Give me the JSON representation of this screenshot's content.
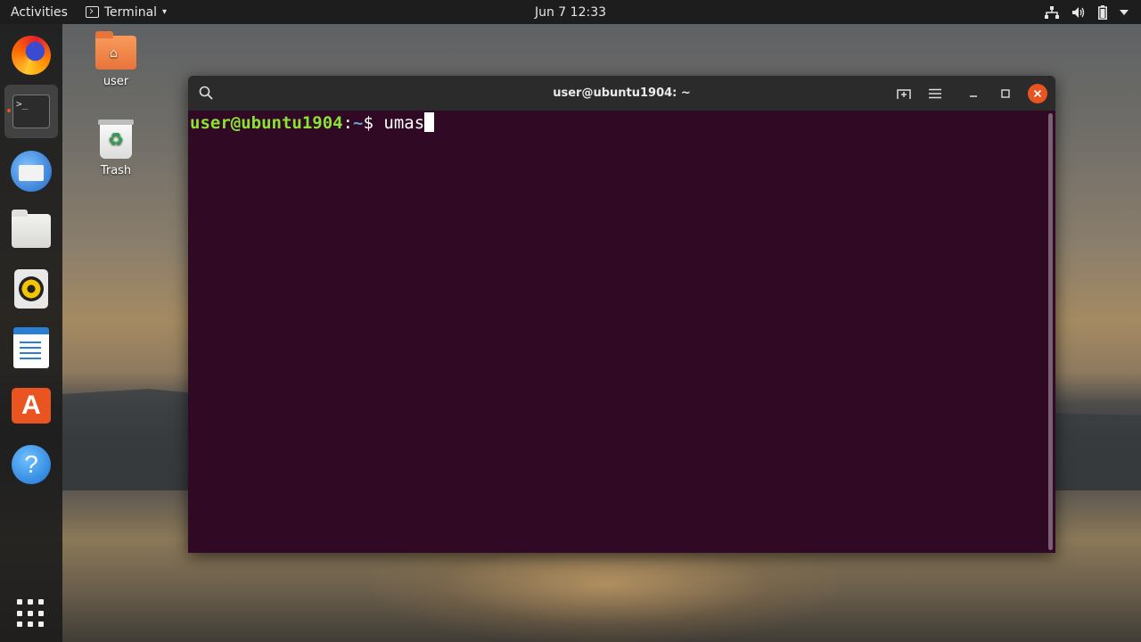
{
  "topbar": {
    "activities": "Activities",
    "app_menu": "Terminal",
    "app_menu_caret": "▾",
    "clock": "Jun 7  12:33"
  },
  "dock": {
    "items": [
      {
        "name": "firefox",
        "icon": "firefox-icon"
      },
      {
        "name": "terminal",
        "icon": "terminal-icon",
        "active": true
      },
      {
        "name": "thunderbird",
        "icon": "thunderbird-icon"
      },
      {
        "name": "files",
        "icon": "files-icon"
      },
      {
        "name": "rhythmbox",
        "icon": "rhythmbox-icon"
      },
      {
        "name": "libreoffice-writer",
        "icon": "writer-icon"
      },
      {
        "name": "ubuntu-software",
        "icon": "software-icon"
      },
      {
        "name": "help",
        "icon": "help-icon"
      }
    ],
    "terminal_glyph": ">_",
    "software_glyph": "A",
    "help_glyph": "?"
  },
  "desktop": {
    "home_label": "user",
    "trash_label": "Trash"
  },
  "terminal": {
    "title": "user@ubuntu1904: ~",
    "prompt_user": "user@ubuntu1904",
    "prompt_colon": ":",
    "prompt_path": "~",
    "prompt_symbol": "$ ",
    "command": "umas"
  },
  "colors": {
    "terminal_bg": "#300a24",
    "prompt_green": "#8ae234",
    "prompt_blue": "#729fcf",
    "accent_orange": "#e95420"
  }
}
